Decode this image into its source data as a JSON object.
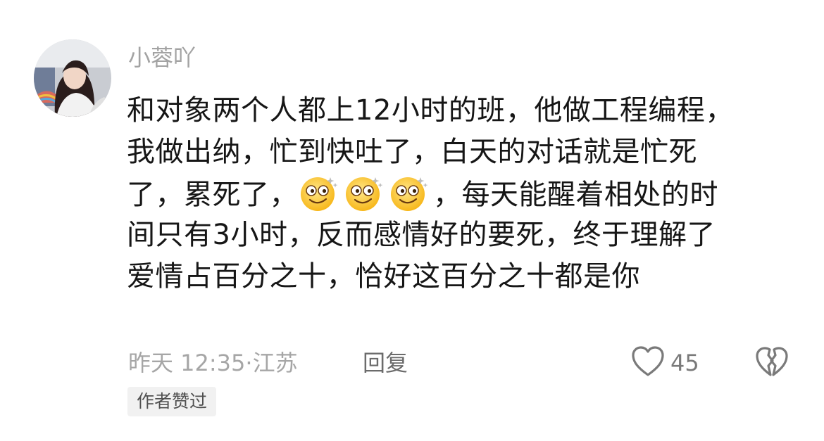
{
  "comment": {
    "username": "小蓉吖",
    "lines": [
      [
        "和对象两个人都上12小时的班，他做工程编程，"
      ],
      [
        "我做出纳，忙到快吐了，白天的对话就是忙死"
      ],
      [
        "了，累死了，",
        "，每天能醒着相处的时"
      ],
      [
        "间只有3小时，反而感情好的要死，终于理解了"
      ],
      [
        "爱情占百分之十，恰好这百分之十都是你"
      ]
    ],
    "emojis": [
      "dizzy-smile-emoji",
      "dizzy-smile-emoji",
      "dizzy-smile-emoji"
    ],
    "timestamp": "昨天 12:35",
    "separator": "·",
    "location": "江苏",
    "reply_label": "回复",
    "like_count": "45",
    "badge": "作者赞过"
  },
  "icons": {
    "like": "heart-outline-icon",
    "dislike": "broken-heart-icon"
  },
  "colors": {
    "text": "#161616",
    "secondary": "#a6a6a6",
    "badge_bg": "#f1f1f1"
  }
}
